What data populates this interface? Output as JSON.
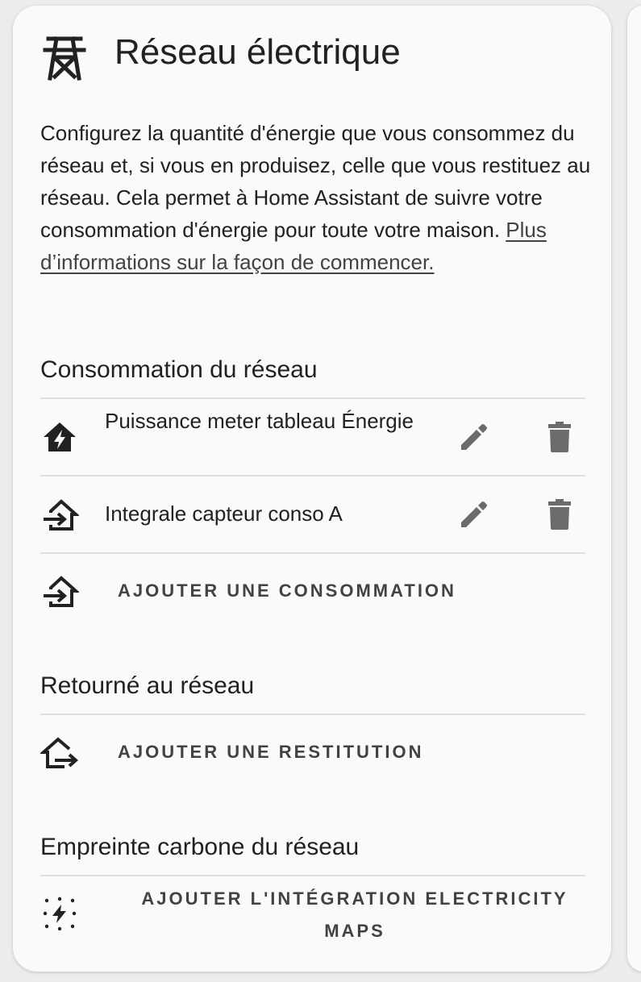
{
  "card": {
    "title": "Réseau électrique",
    "icon": "transmission-tower-icon",
    "description_text": "Configurez la quantité d'énergie que vous consommez du réseau et, si vous en produisez, celle que vous restituez au réseau. Cela permet à Home Assistant de suivre votre consommation d'énergie pour toute votre maison. ",
    "description_link": "Plus d’informations sur la façon de commencer."
  },
  "consumption": {
    "title": "Consommation du réseau",
    "items": [
      {
        "label": "Puissance meter tableau Énergie",
        "icon": "home-lightning-icon"
      },
      {
        "label": "Integrale capteur conso A",
        "icon": "home-import-icon"
      }
    ],
    "add_label": "AJOUTER UNE CONSOMMATION",
    "add_icon": "home-import-icon"
  },
  "return": {
    "title": "Retourné au réseau",
    "add_label": "AJOUTER UNE RESTITUTION",
    "add_icon": "home-export-icon"
  },
  "carbon": {
    "title": "Empreinte carbone du réseau",
    "add_label_line1": "AJOUTER L'INTÉGRATION ELECTRICITY",
    "add_label_line2": "MAPS",
    "add_icon": "lightning-dots-icon"
  },
  "colors": {
    "card_bg": "#fafafa",
    "text": "#212121",
    "icon_gray": "#6b6b6b",
    "divider": "#e0e0e0"
  }
}
